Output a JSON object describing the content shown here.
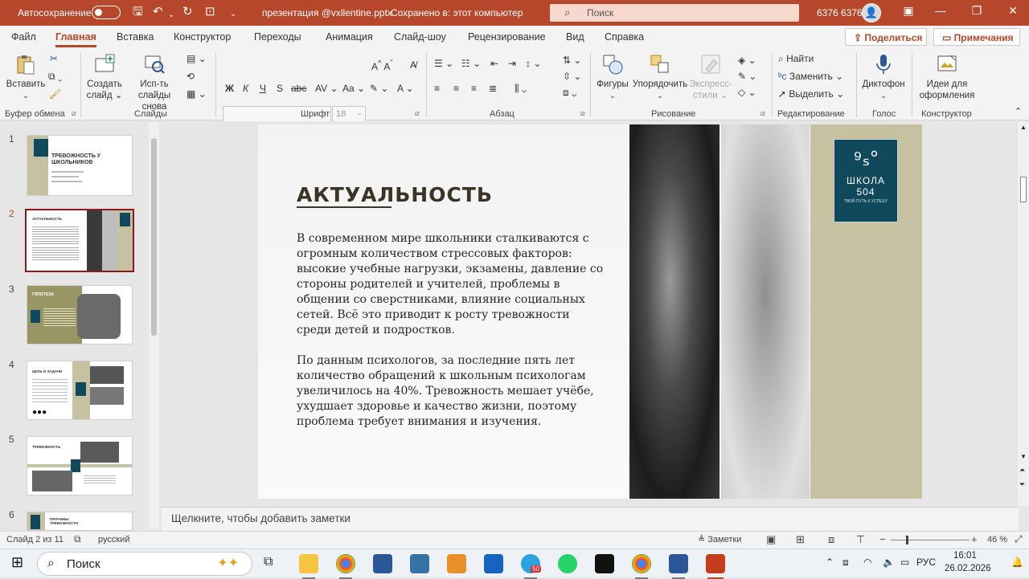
{
  "titlebar": {
    "autosave_label": "Автосохранение",
    "toggle_state": "Откл",
    "document": "презентация @vxllentine.pptx",
    "saved_status": "Сохранено в: этот компьютер",
    "search_placeholder": "Поиск",
    "user": "6376 6376",
    "accent": "#b7472a"
  },
  "menu": {
    "items": [
      "Файл",
      "Главная",
      "Вставка",
      "Конструктор",
      "Переходы",
      "Анимация",
      "Слайд-шоу",
      "Рецензирование",
      "Вид",
      "Справка"
    ],
    "active": "Главная",
    "share": "Поделиться",
    "comments": "Примечания"
  },
  "ribbon": {
    "paste": "Вставить",
    "new_slide_1": "Создать",
    "new_slide_2": "слайд",
    "from_outline_1": "Исп-ть",
    "from_outline_2": "слайды снова",
    "font_size": "18",
    "shapes": "Фигуры",
    "arrange": "Упорядочить",
    "quick_styles_1": "Экспресс-",
    "quick_styles_2": "стили",
    "find": "Найти",
    "replace": "Заменить",
    "select": "Выделить",
    "dictate": "Диктофон",
    "designer_1": "Идеи для",
    "designer_2": "оформления",
    "groups": {
      "clipboard": "Буфер обмена",
      "slides": "Слайды",
      "font": "Шрифт",
      "paragraph": "Абзац",
      "drawing": "Рисование",
      "editing": "Редактирование",
      "voice": "Голос",
      "designer": "Конструктор"
    }
  },
  "thumbnails": [
    {
      "num": "1",
      "title": "ТРЕВОЖНОСТЬ У ШКОЛЬНИКОВ"
    },
    {
      "num": "2",
      "title": "АКТУАЛЬНОСТЬ"
    },
    {
      "num": "3",
      "title": "ГИПОТЕЗА"
    },
    {
      "num": "4",
      "title": "ЦЕЛЬ И ЗАДАЧИ"
    },
    {
      "num": "5",
      "title": "ТРЕВОЖНОСТЬ"
    },
    {
      "num": "6",
      "title": "ПРИЧИНЫ ТРЕВОЖНОСТИ"
    }
  ],
  "slide": {
    "title": "АКТУАЛЬНОСТЬ",
    "paragraph1": "В современном мире школьники сталкиваются с огромным количеством стрессовых факторов: высокие учебные нагрузки, экзамены, давление со стороны родителей и учителей, проблемы в общении со сверстниками, влияние социальных сетей. Всё это приводит к росту тревожности среди детей и подростков.",
    "paragraph2": "По данным психологов, за последние пять лет количество обращений к школьным психологам увеличилось на 40%. Тревожность мешает учёбе, ухудшает здоровье и качество жизни, поэтому проблема требует внимания и изучения.",
    "logo_line1": "ШКОЛА",
    "logo_line2": "504",
    "logo_tagline": "ТВОЙ ПУТЬ К УСПЕХУ"
  },
  "notes_placeholder": "Щелкните, чтобы добавить заметки",
  "status": {
    "slide_of": "Слайд 2 из 11",
    "language": "русский",
    "notes_btn": "Заметки",
    "zoom": "46 %"
  },
  "taskbar": {
    "search": "Поиск",
    "telegram_badge": "50",
    "language": "РУС",
    "time": "16:01",
    "date": "26.02.2026"
  }
}
